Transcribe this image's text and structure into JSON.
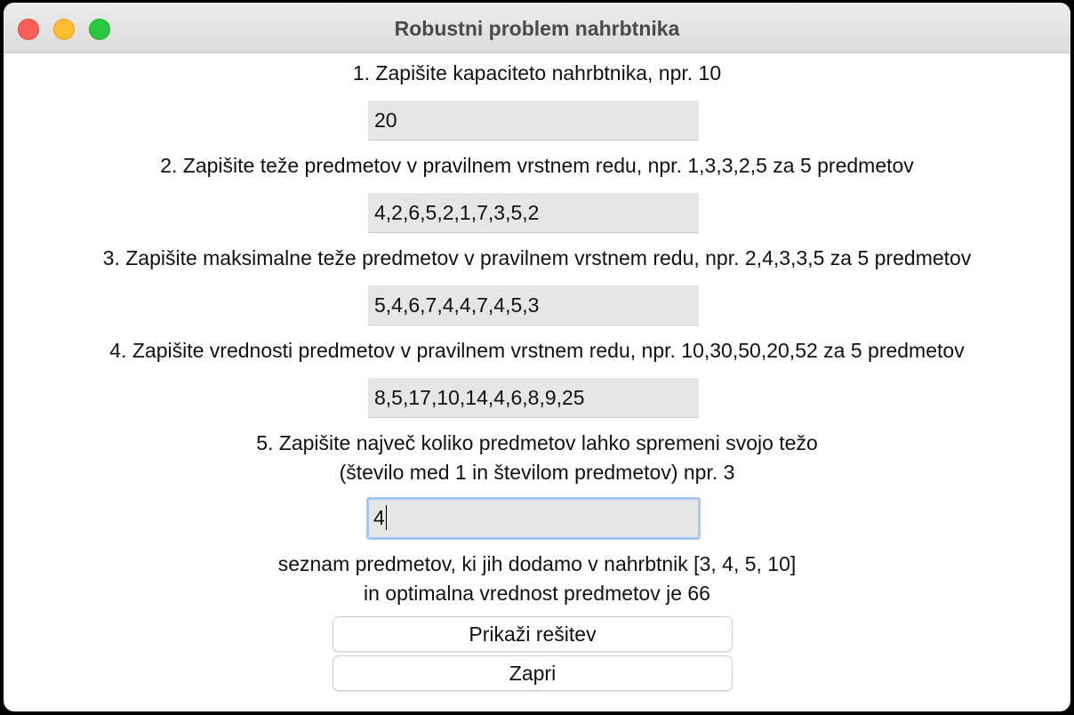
{
  "window": {
    "title": "Robustni problem nahrbtnika"
  },
  "form": {
    "steps": [
      {
        "label_lines": [
          "1. Zapišite kapaciteto nahrbtnika, npr. 10"
        ],
        "value": "20"
      },
      {
        "label_lines": [
          "2. Zapišite teže predmetov v pravilnem vrstnem redu, npr. 1,3,3,2,5 za 5 predmetov"
        ],
        "value": "4,2,6,5,2,1,7,3,5,2"
      },
      {
        "label_lines": [
          "3. Zapišite maksimalne teže predmetov v pravilnem vrstnem redu, npr. 2,4,3,3,5 za 5 predmetov"
        ],
        "value": "5,4,6,7,4,4,7,4,5,3"
      },
      {
        "label_lines": [
          "4. Zapišite vrednosti predmetov v pravilnem vrstnem redu, npr. 10,30,50,20,52 za 5 predmetov"
        ],
        "value": "8,5,17,10,14,4,6,8,9,25"
      },
      {
        "label_lines": [
          "5. Zapišite največ koliko predmetov lahko spremeni svojo težo",
          "(število med 1 in številom predmetov) npr. 3"
        ],
        "value": "4"
      }
    ]
  },
  "result": {
    "lines": [
      "seznam predmetov, ki jih dodamo v nahrbtnik [3, 4, 5, 10]",
      "in optimalna vrednost predmetov je 66"
    ]
  },
  "buttons": {
    "show_solution": "Prikaži rešitev",
    "close": "Zapri"
  },
  "colors": {
    "close_light": "#ff5f57",
    "minimize_light": "#febc2e",
    "maximize_light": "#28c840",
    "focus_ring": "#a6c8f5",
    "field_background": "#e6e6e6"
  }
}
